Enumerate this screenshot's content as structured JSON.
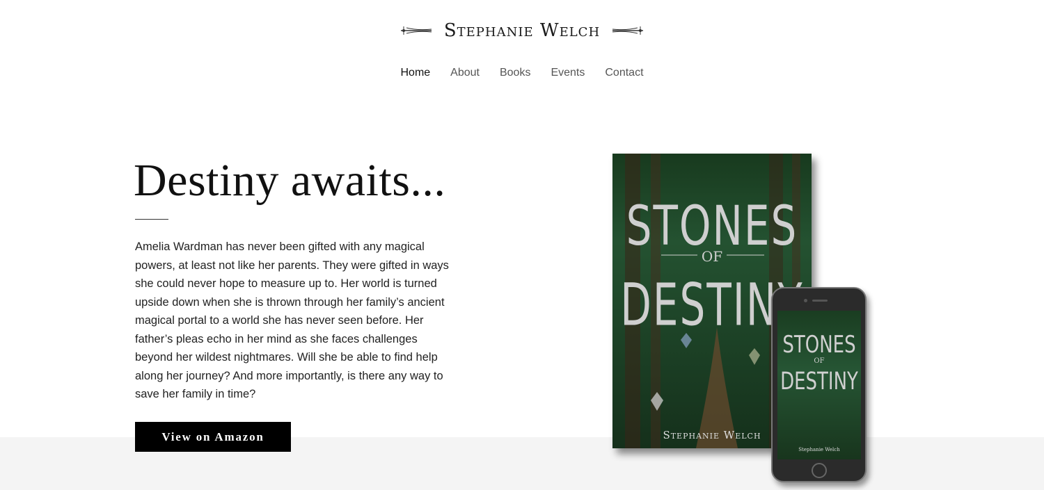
{
  "site": {
    "logo_text": "Stephanie Welch"
  },
  "nav": {
    "items": [
      {
        "label": "Home",
        "active": true
      },
      {
        "label": "About",
        "active": false
      },
      {
        "label": "Books",
        "active": false
      },
      {
        "label": "Events",
        "active": false
      },
      {
        "label": "Contact",
        "active": false
      }
    ]
  },
  "hero": {
    "headline": "Destiny awaits...",
    "description": "Amelia Wardman has never been gifted with any magical powers, at least not like her parents. They were gifted in ways she could never hope to measure up to. Her world is turned upside down when she is thrown through her family’s ancient magical portal to a world she has never seen before. Her father’s pleas echo in her mind as she faces challenges beyond her wildest nightmares. Will she be able to find help along her journey? And more importantly, is there any way to save her family in time?",
    "cta_label": "View on Amazon"
  },
  "book_cover": {
    "title_line_1": "STONES",
    "title_of": "OF",
    "title_line_2": "DESTINY",
    "author": "Stephanie Welch"
  },
  "colors": {
    "button_bg": "#000000",
    "band_bg": "#f4f4f4",
    "cover_green": "#245231"
  }
}
